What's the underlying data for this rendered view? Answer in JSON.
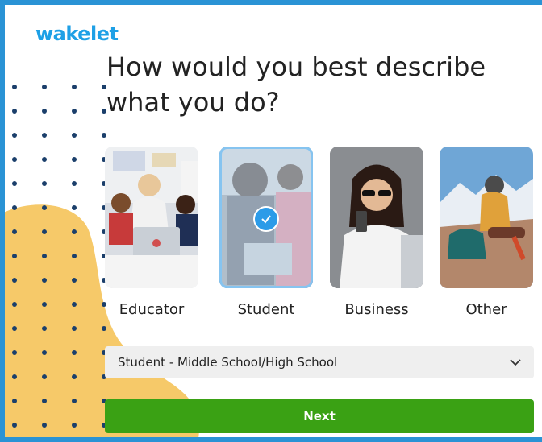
{
  "brand": {
    "logo": "wakelet",
    "color": "#1ea0e6",
    "frame_color": "#2a93d5",
    "blob_color": "#f6c969",
    "accent": "#2c9be8",
    "next_color": "#3aa114"
  },
  "question": {
    "title": "How would you best describe what you do?"
  },
  "options": [
    {
      "label": "Educator",
      "selected": false,
      "image": "teacher-with-students-photo"
    },
    {
      "label": "Student",
      "selected": true,
      "image": "students-with-laptop-photo"
    },
    {
      "label": "Business",
      "selected": false,
      "image": "woman-with-phone-photo"
    },
    {
      "label": "Other",
      "selected": false,
      "image": "hiker-on-mountain-photo"
    }
  ],
  "student_type": {
    "value": "Student - Middle School/High School",
    "icon": "chevron-down-icon"
  },
  "next_button": {
    "label": "Next"
  }
}
